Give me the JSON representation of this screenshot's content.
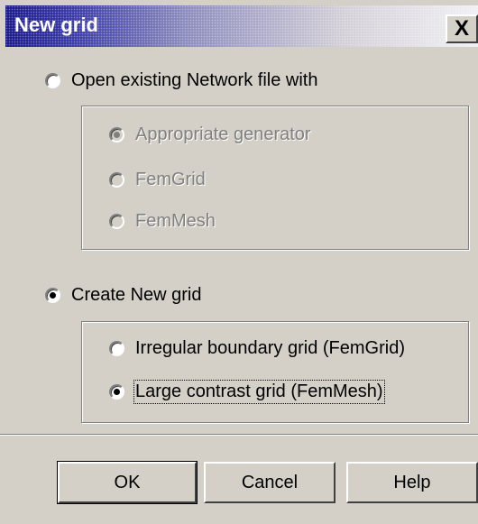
{
  "window": {
    "title": "New grid",
    "close_glyph": "X"
  },
  "open_existing": {
    "label": "Open existing Network file with",
    "selected": false,
    "options": [
      {
        "label": "Appropriate generator",
        "selected": true,
        "enabled": false
      },
      {
        "label": "FemGrid",
        "selected": false,
        "enabled": false
      },
      {
        "label": "FemMesh",
        "selected": false,
        "enabled": false
      }
    ]
  },
  "create_new": {
    "label": "Create New grid",
    "selected": true,
    "options": [
      {
        "label": "Irregular boundary grid (FemGrid)",
        "selected": false,
        "enabled": true
      },
      {
        "label": "Large contrast grid (FemMesh)",
        "selected": true,
        "enabled": true
      }
    ]
  },
  "buttons": {
    "ok": "OK",
    "cancel": "Cancel",
    "help": "Help"
  }
}
